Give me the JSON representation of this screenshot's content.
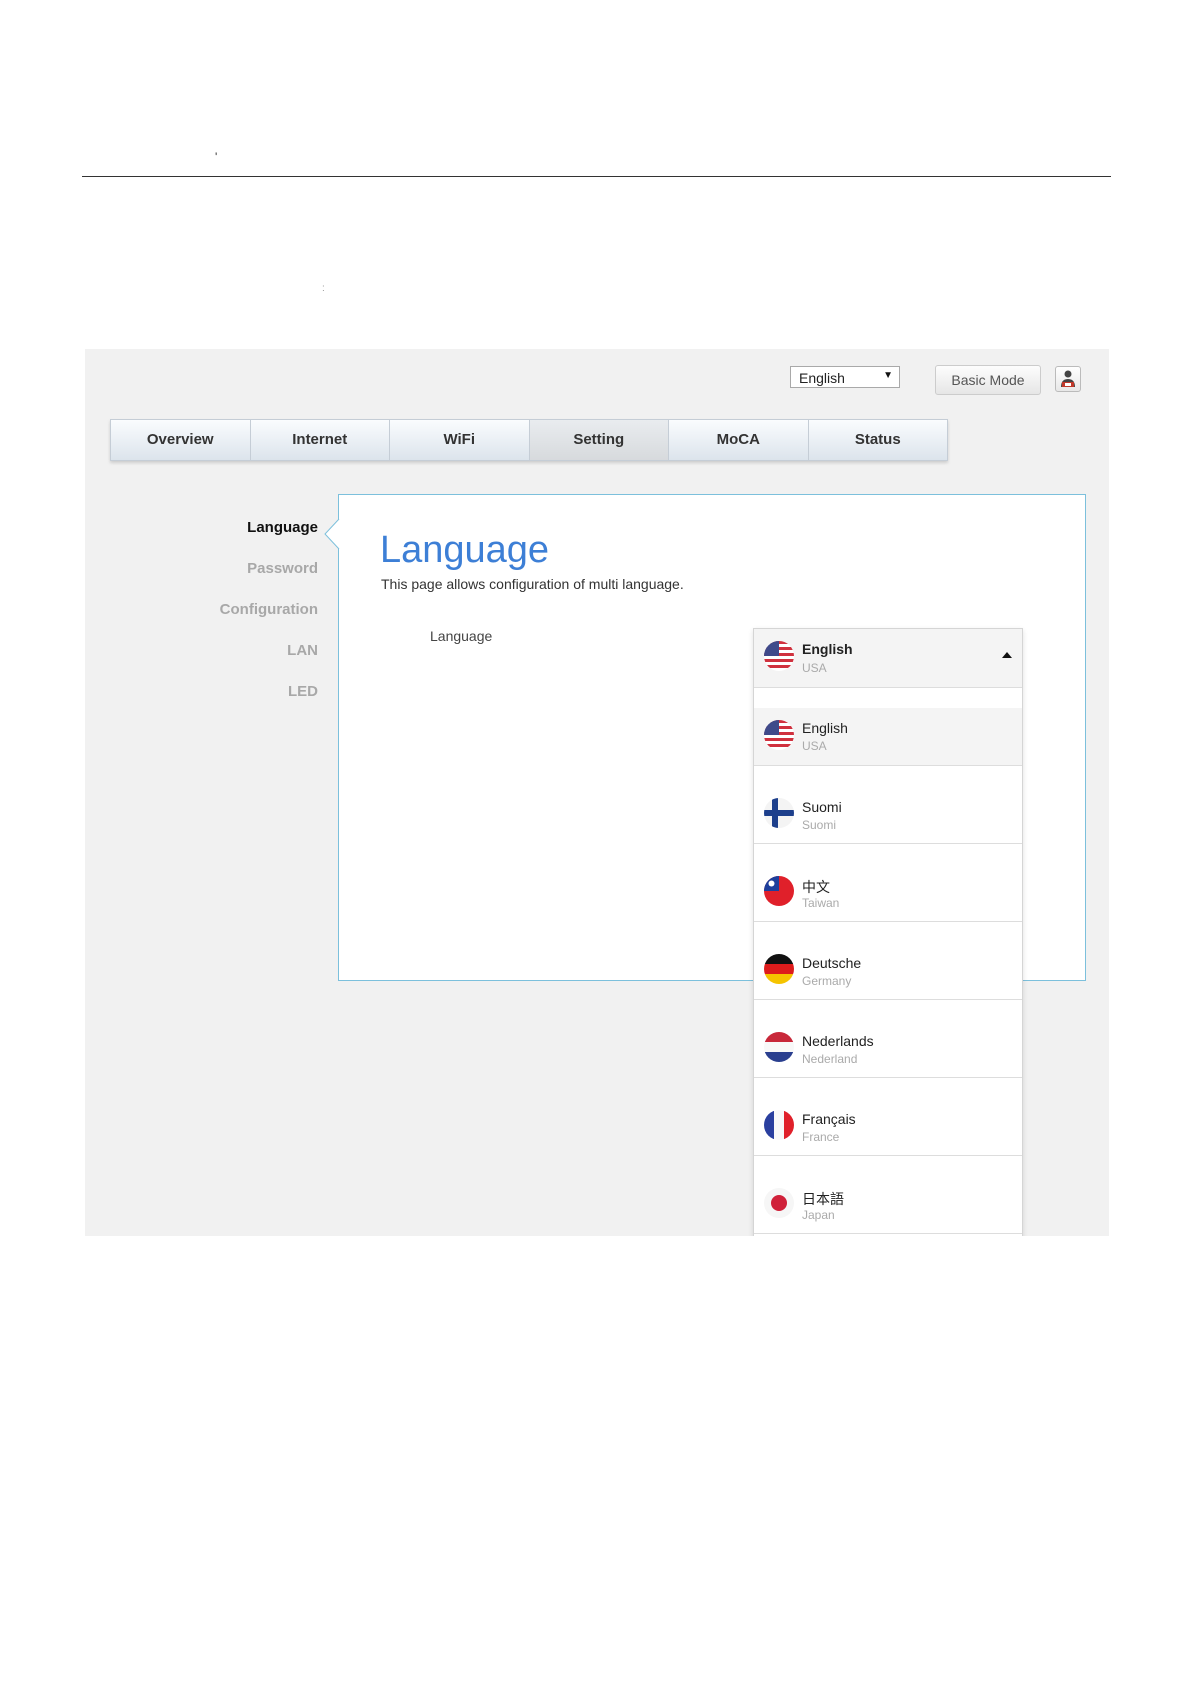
{
  "doc": {
    "mark1": "'",
    "mark2": ":"
  },
  "topbar": {
    "language_select": "English",
    "basic_mode_label": "Basic Mode"
  },
  "tabs": [
    {
      "label": "Overview"
    },
    {
      "label": "Internet"
    },
    {
      "label": "WiFi"
    },
    {
      "label": "Setting"
    },
    {
      "label": "MoCA"
    },
    {
      "label": "Status"
    }
  ],
  "active_tab": "Setting",
  "sidebar": {
    "items": [
      {
        "label": "Language"
      },
      {
        "label": "Password"
      },
      {
        "label": "Configuration"
      },
      {
        "label": "LAN"
      },
      {
        "label": "LED"
      }
    ],
    "active": "Language"
  },
  "panel": {
    "title": "Language",
    "description": "This page allows configuration of multi language.",
    "field_label": "Language"
  },
  "dropdown": {
    "selected": {
      "name": "English",
      "region": "USA",
      "flag": "us-flag-icon"
    },
    "options": [
      {
        "name": "English",
        "region": "USA",
        "flag": "us-flag-icon"
      },
      {
        "name": "Suomi",
        "region": "Suomi",
        "flag": "finland-flag-icon"
      },
      {
        "name": "中文",
        "region": "Taiwan",
        "flag": "taiwan-flag-icon"
      },
      {
        "name": "Deutsche",
        "region": "Germany",
        "flag": "germany-flag-icon"
      },
      {
        "name": "Nederlands",
        "region": "Nederland",
        "flag": "netherlands-flag-icon"
      },
      {
        "name": "Français",
        "region": "France",
        "flag": "france-flag-icon"
      },
      {
        "name": "日本語",
        "region": "Japan",
        "flag": "japan-flag-icon"
      }
    ]
  },
  "colors": {
    "accent": "#3d7fd6",
    "panel_border": "#7cc0dc",
    "background": "#f1f1f1"
  }
}
